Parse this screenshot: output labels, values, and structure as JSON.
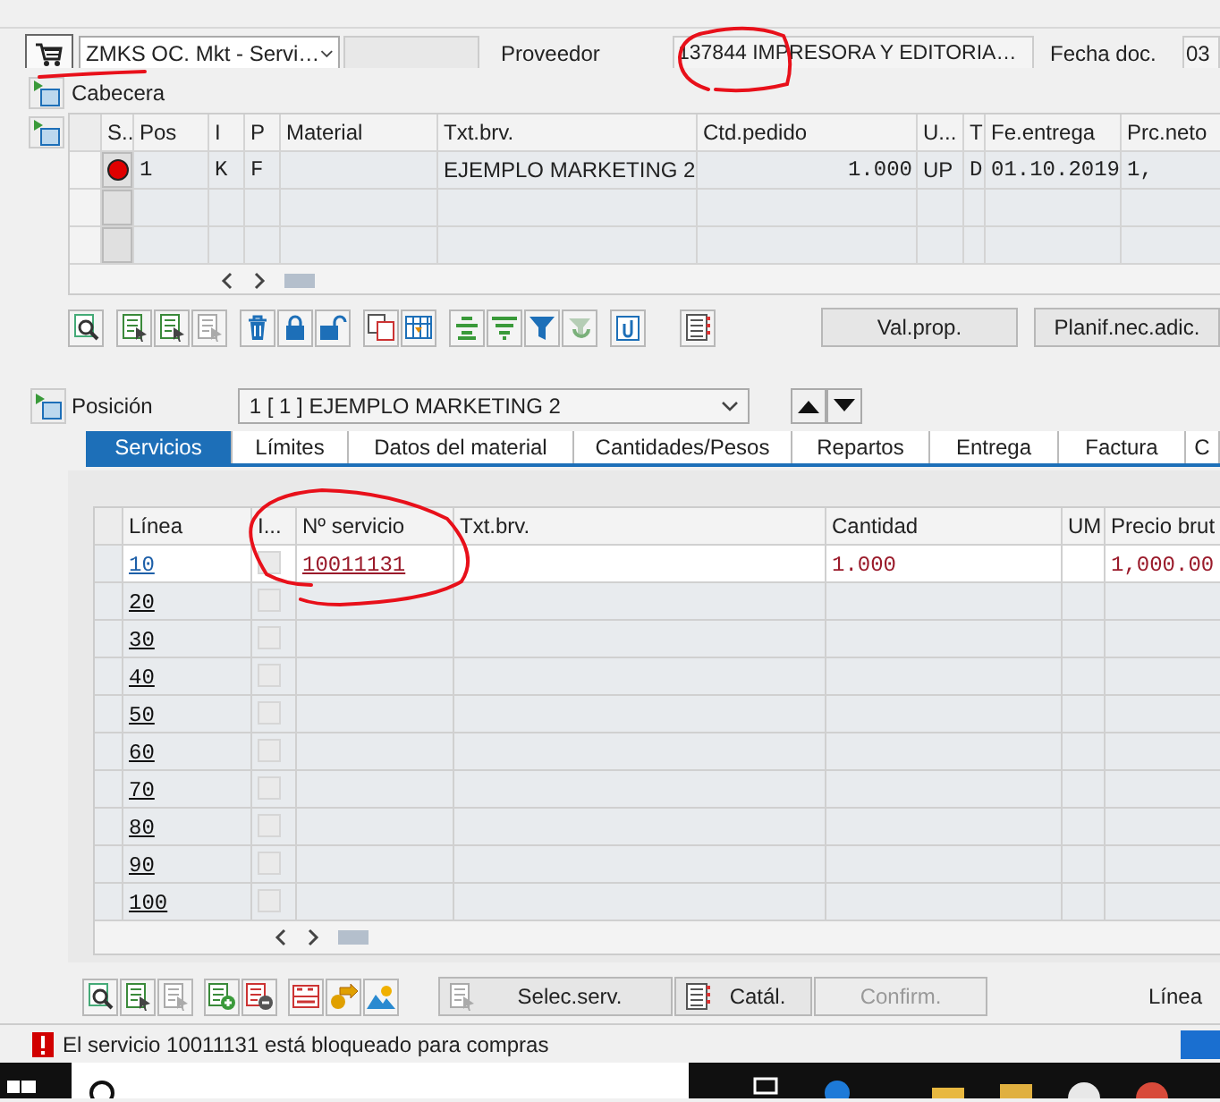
{
  "header": {
    "doc_type": "ZMKS OC. Mkt - Servi…",
    "vendor_label": "Proveedor",
    "vendor_value": "137844 IMPRESORA Y EDITORIA…",
    "date_label": "Fecha doc.",
    "date_value": "03"
  },
  "header_section": {
    "label": "Cabecera",
    "expanded": false
  },
  "items": {
    "columns": [
      "S..",
      "Pos",
      "I",
      "P",
      "Material",
      "Txt.brv.",
      "Ctd.pedido",
      "U...",
      "T",
      "Fe.entrega",
      "Prc.neto"
    ],
    "rows": [
      {
        "color": "#e00000",
        "cells": [
          "",
          "1",
          "K",
          "F",
          "",
          "EJEMPLO MARKETING 2",
          "1.000",
          "UP",
          "D",
          "01.10.2019",
          "1,"
        ]
      }
    ]
  },
  "item_toolbar": {
    "buttons": [
      "Val.prop.",
      "Planif.nec.adic."
    ]
  },
  "position": {
    "label": "Posición",
    "value": "1 [ 1 ] EJEMPLO MARKETING 2"
  },
  "tabs": [
    {
      "label": "Servicios",
      "selected": true
    },
    {
      "label": "Límites",
      "selected": false
    },
    {
      "label": "Datos del material",
      "selected": false
    },
    {
      "label": "Cantidades/Pesos",
      "selected": false
    },
    {
      "label": "Repartos",
      "selected": false
    },
    {
      "label": "Entrega",
      "selected": false
    },
    {
      "label": "Factura",
      "selected": false
    },
    {
      "label": "C",
      "selected": false
    }
  ],
  "services": {
    "columns": [
      "Línea",
      "I...",
      "Nº servicio",
      "Txt.brv.",
      "Cantidad",
      "UM",
      "Precio brut"
    ],
    "rows": [
      {
        "line": "10",
        "editable": true,
        "checked": false,
        "service": "10011131",
        "quantity": "1.000",
        "price": "1,000.00"
      },
      {
        "line": "20",
        "editable": false,
        "checked": false
      },
      {
        "line": "30",
        "editable": false,
        "checked": false
      },
      {
        "line": "40",
        "editable": false,
        "checked": false
      },
      {
        "line": "50",
        "editable": false,
        "checked": false
      },
      {
        "line": "60",
        "editable": false,
        "checked": false
      },
      {
        "line": "70",
        "editable": false,
        "checked": false
      },
      {
        "line": "80",
        "editable": false,
        "checked": false
      },
      {
        "line": "90",
        "editable": false,
        "checked": false
      },
      {
        "line": "100",
        "editable": false,
        "checked": false
      }
    ]
  },
  "bottom_toolbar": {
    "buttons": [
      {
        "label": "Selec.serv.",
        "disabled": false
      },
      {
        "label": "Catál.",
        "disabled": false
      },
      {
        "label": "Confirm.",
        "disabled": true
      }
    ],
    "right_label": "Línea"
  },
  "status_bar": {
    "message": "El servicio 10011131 está bloqueado para compras"
  }
}
